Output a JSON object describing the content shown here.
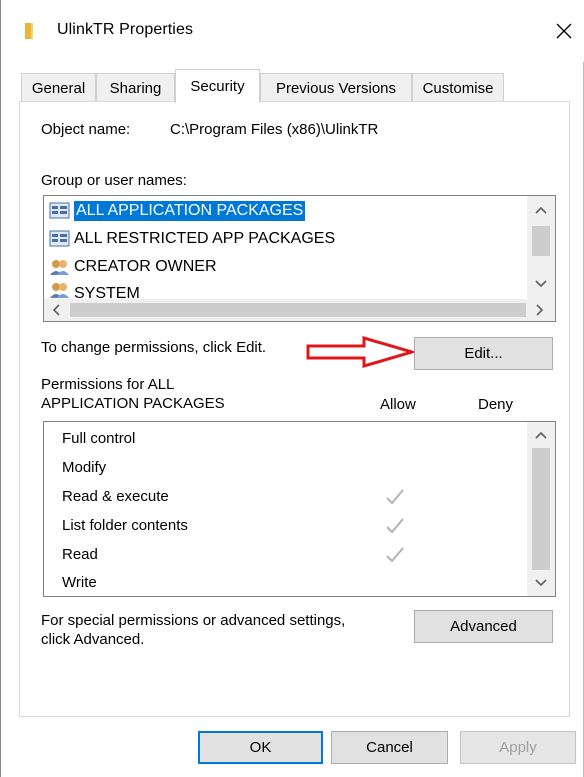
{
  "window": {
    "title": "UlinkTR Properties"
  },
  "tabs": [
    {
      "label": "General"
    },
    {
      "label": "Sharing"
    },
    {
      "label": "Security",
      "active": true
    },
    {
      "label": "Previous Versions"
    },
    {
      "label": "Customise"
    }
  ],
  "security": {
    "object_label": "Object name:",
    "object_value": "C:\\Program Files (x86)\\UlinkTR",
    "group_label": "Group or user names:",
    "groups": [
      {
        "name": "ALL APPLICATION PACKAGES",
        "icon": "app-package-icon",
        "selected": true
      },
      {
        "name": "ALL RESTRICTED APP PACKAGES",
        "icon": "app-package-icon",
        "selected": false
      },
      {
        "name": "CREATOR OWNER",
        "icon": "users-icon",
        "selected": false
      },
      {
        "name": "SYSTEM",
        "icon": "users-icon",
        "selected": false
      }
    ],
    "change_text": "To change permissions, click Edit.",
    "edit_label": "Edit...",
    "perm_header_line1": "Permissions for ALL",
    "perm_header_line2": "APPLICATION PACKAGES",
    "allow_label": "Allow",
    "deny_label": "Deny",
    "permissions": [
      {
        "name": "Full control",
        "allow": false,
        "deny": false
      },
      {
        "name": "Modify",
        "allow": false,
        "deny": false
      },
      {
        "name": "Read & execute",
        "allow": true,
        "deny": false
      },
      {
        "name": "List folder contents",
        "allow": true,
        "deny": false
      },
      {
        "name": "Read",
        "allow": true,
        "deny": false
      },
      {
        "name": "Write",
        "allow": false,
        "deny": false
      }
    ],
    "special_line1": "For special permissions or advanced settings,",
    "special_line2": "click Advanced.",
    "advanced_label": "Advanced"
  },
  "footer": {
    "ok_label": "OK",
    "cancel_label": "Cancel",
    "apply_label": "Apply"
  },
  "colors": {
    "selection": "#0078d7",
    "annotation_arrow": "#e0161b",
    "check": "#b3b3b3"
  }
}
